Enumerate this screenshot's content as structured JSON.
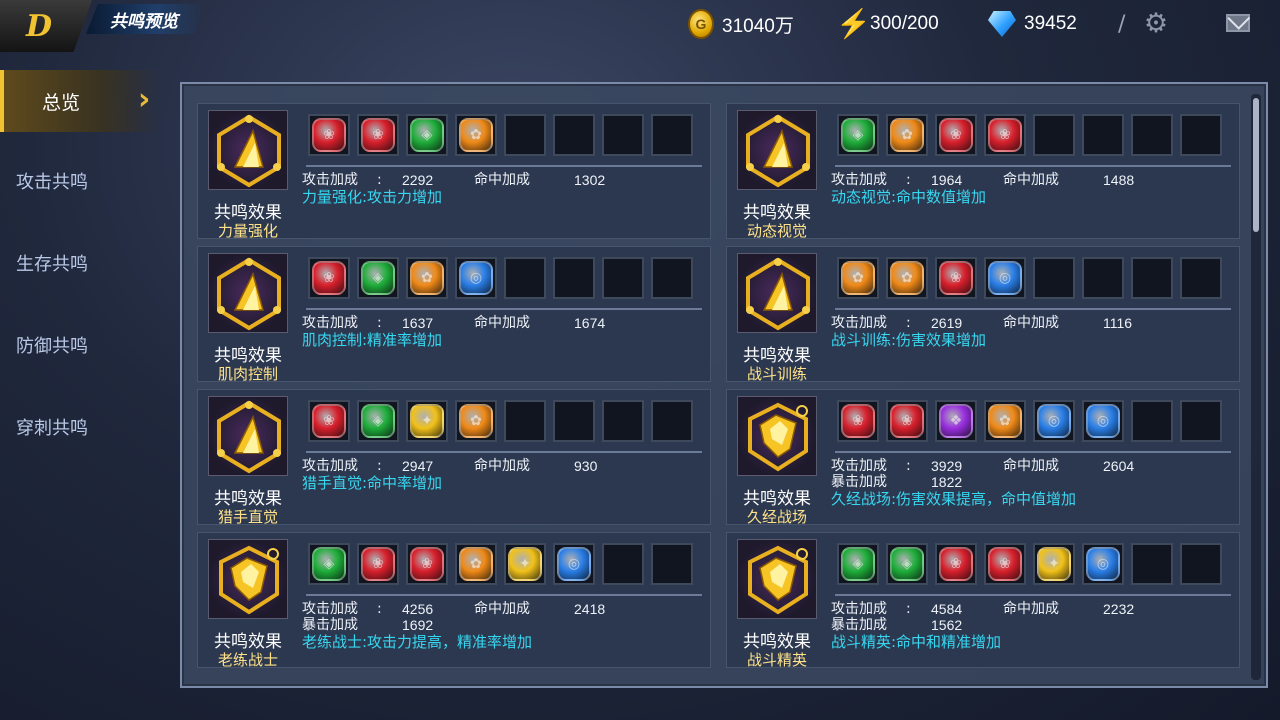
{
  "header": {
    "logo": "D",
    "title": "共鸣预览",
    "gold": "31040万",
    "stamina": "300/200",
    "diamonds": "39452",
    "separator": "/",
    "icons": [
      "coin-icon",
      "lightning-icon",
      "diamond-icon",
      "gear-icon",
      "mail-icon"
    ]
  },
  "sidebar": {
    "active": "总览",
    "items": [
      "攻击共鸣",
      "生存共鸣",
      "防御共鸣",
      "穿刺共鸣"
    ]
  },
  "colors": {
    "red": "#d8202c",
    "green": "#1fae3a",
    "orange": "#f08a18",
    "blue": "#2a7fe8",
    "yellow": "#f2c21a",
    "purple": "#9a2ee0",
    "accent_gold": "#f1c232",
    "desc_cyan": "#37d7f0"
  },
  "common": {
    "effect_label": "共鸣效果",
    "attack_label": "攻击加成",
    "hit_label": "命中加成",
    "crit_label": "暴击加成",
    "colon": ":"
  },
  "cards": [
    {
      "emblem": "triangle",
      "name": "力量强化",
      "gems": [
        "red",
        "red",
        "green",
        "orange"
      ],
      "attack": "2292",
      "hit": "1302",
      "crit": null,
      "desc": "力量强化:攻击力增加"
    },
    {
      "emblem": "triangle",
      "name": "动态视觉",
      "gems": [
        "green",
        "orange",
        "red",
        "red"
      ],
      "attack": "1964",
      "hit": "1488",
      "crit": null,
      "desc": "动态视觉:命中数值增加"
    },
    {
      "emblem": "triangle",
      "name": "肌肉控制",
      "gems": [
        "red",
        "green",
        "orange",
        "blue"
      ],
      "attack": "1637",
      "hit": "1674",
      "crit": null,
      "desc": "肌肉控制:精准率增加"
    },
    {
      "emblem": "triangle",
      "name": "战斗训练",
      "gems": [
        "orange",
        "orange",
        "red",
        "blue"
      ],
      "attack": "2619",
      "hit": "1116",
      "crit": null,
      "desc": "战斗训练:伤害效果增加"
    },
    {
      "emblem": "triangle",
      "name": "猎手直觉",
      "gems": [
        "red",
        "green",
        "yellow",
        "orange"
      ],
      "attack": "2947",
      "hit": "930",
      "crit": null,
      "desc": "猎手直觉:命中率增加"
    },
    {
      "emblem": "hexagon",
      "name": "久经战场",
      "gems": [
        "red",
        "red",
        "purple",
        "orange",
        "blue",
        "blue"
      ],
      "attack": "3929",
      "hit": "2604",
      "crit": "1822",
      "desc": "久经战场:伤害效果提高，命中值增加"
    },
    {
      "emblem": "hexagon",
      "name": "老练战士",
      "gems": [
        "green",
        "red",
        "red",
        "orange",
        "yellow",
        "blue"
      ],
      "attack": "4256",
      "hit": "2418",
      "crit": "1692",
      "desc": "老练战士:攻击力提高，精准率增加"
    },
    {
      "emblem": "hexagon",
      "name": "战斗精英",
      "gems": [
        "green",
        "green",
        "red",
        "red",
        "yellow",
        "blue"
      ],
      "attack": "4584",
      "hit": "2232",
      "crit": "1562",
      "desc": "战斗精英:命中和精准增加"
    }
  ]
}
